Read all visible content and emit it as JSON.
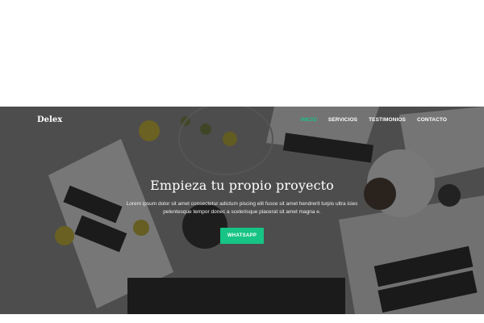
{
  "nav": {
    "brand": "Delex",
    "links": [
      {
        "label": "INICIO",
        "active": true
      },
      {
        "label": "SERVICIOS",
        "active": false
      },
      {
        "label": "TESTIMONIOS",
        "active": false
      },
      {
        "label": "CONTACTO",
        "active": false
      }
    ]
  },
  "hero": {
    "title": "Empieza tu propio proyecto",
    "text": "Lorem ipsum dolor sit amet consectetur adictum piscing elit fusce sit amet hendrerit turpis ultra icies pelentesque tempor donec a scelerisque placerat sit amet magna e.",
    "cta_label": "WHATSAPP"
  },
  "colors": {
    "accent": "#17c486",
    "overlay": "#1c1c1c"
  }
}
